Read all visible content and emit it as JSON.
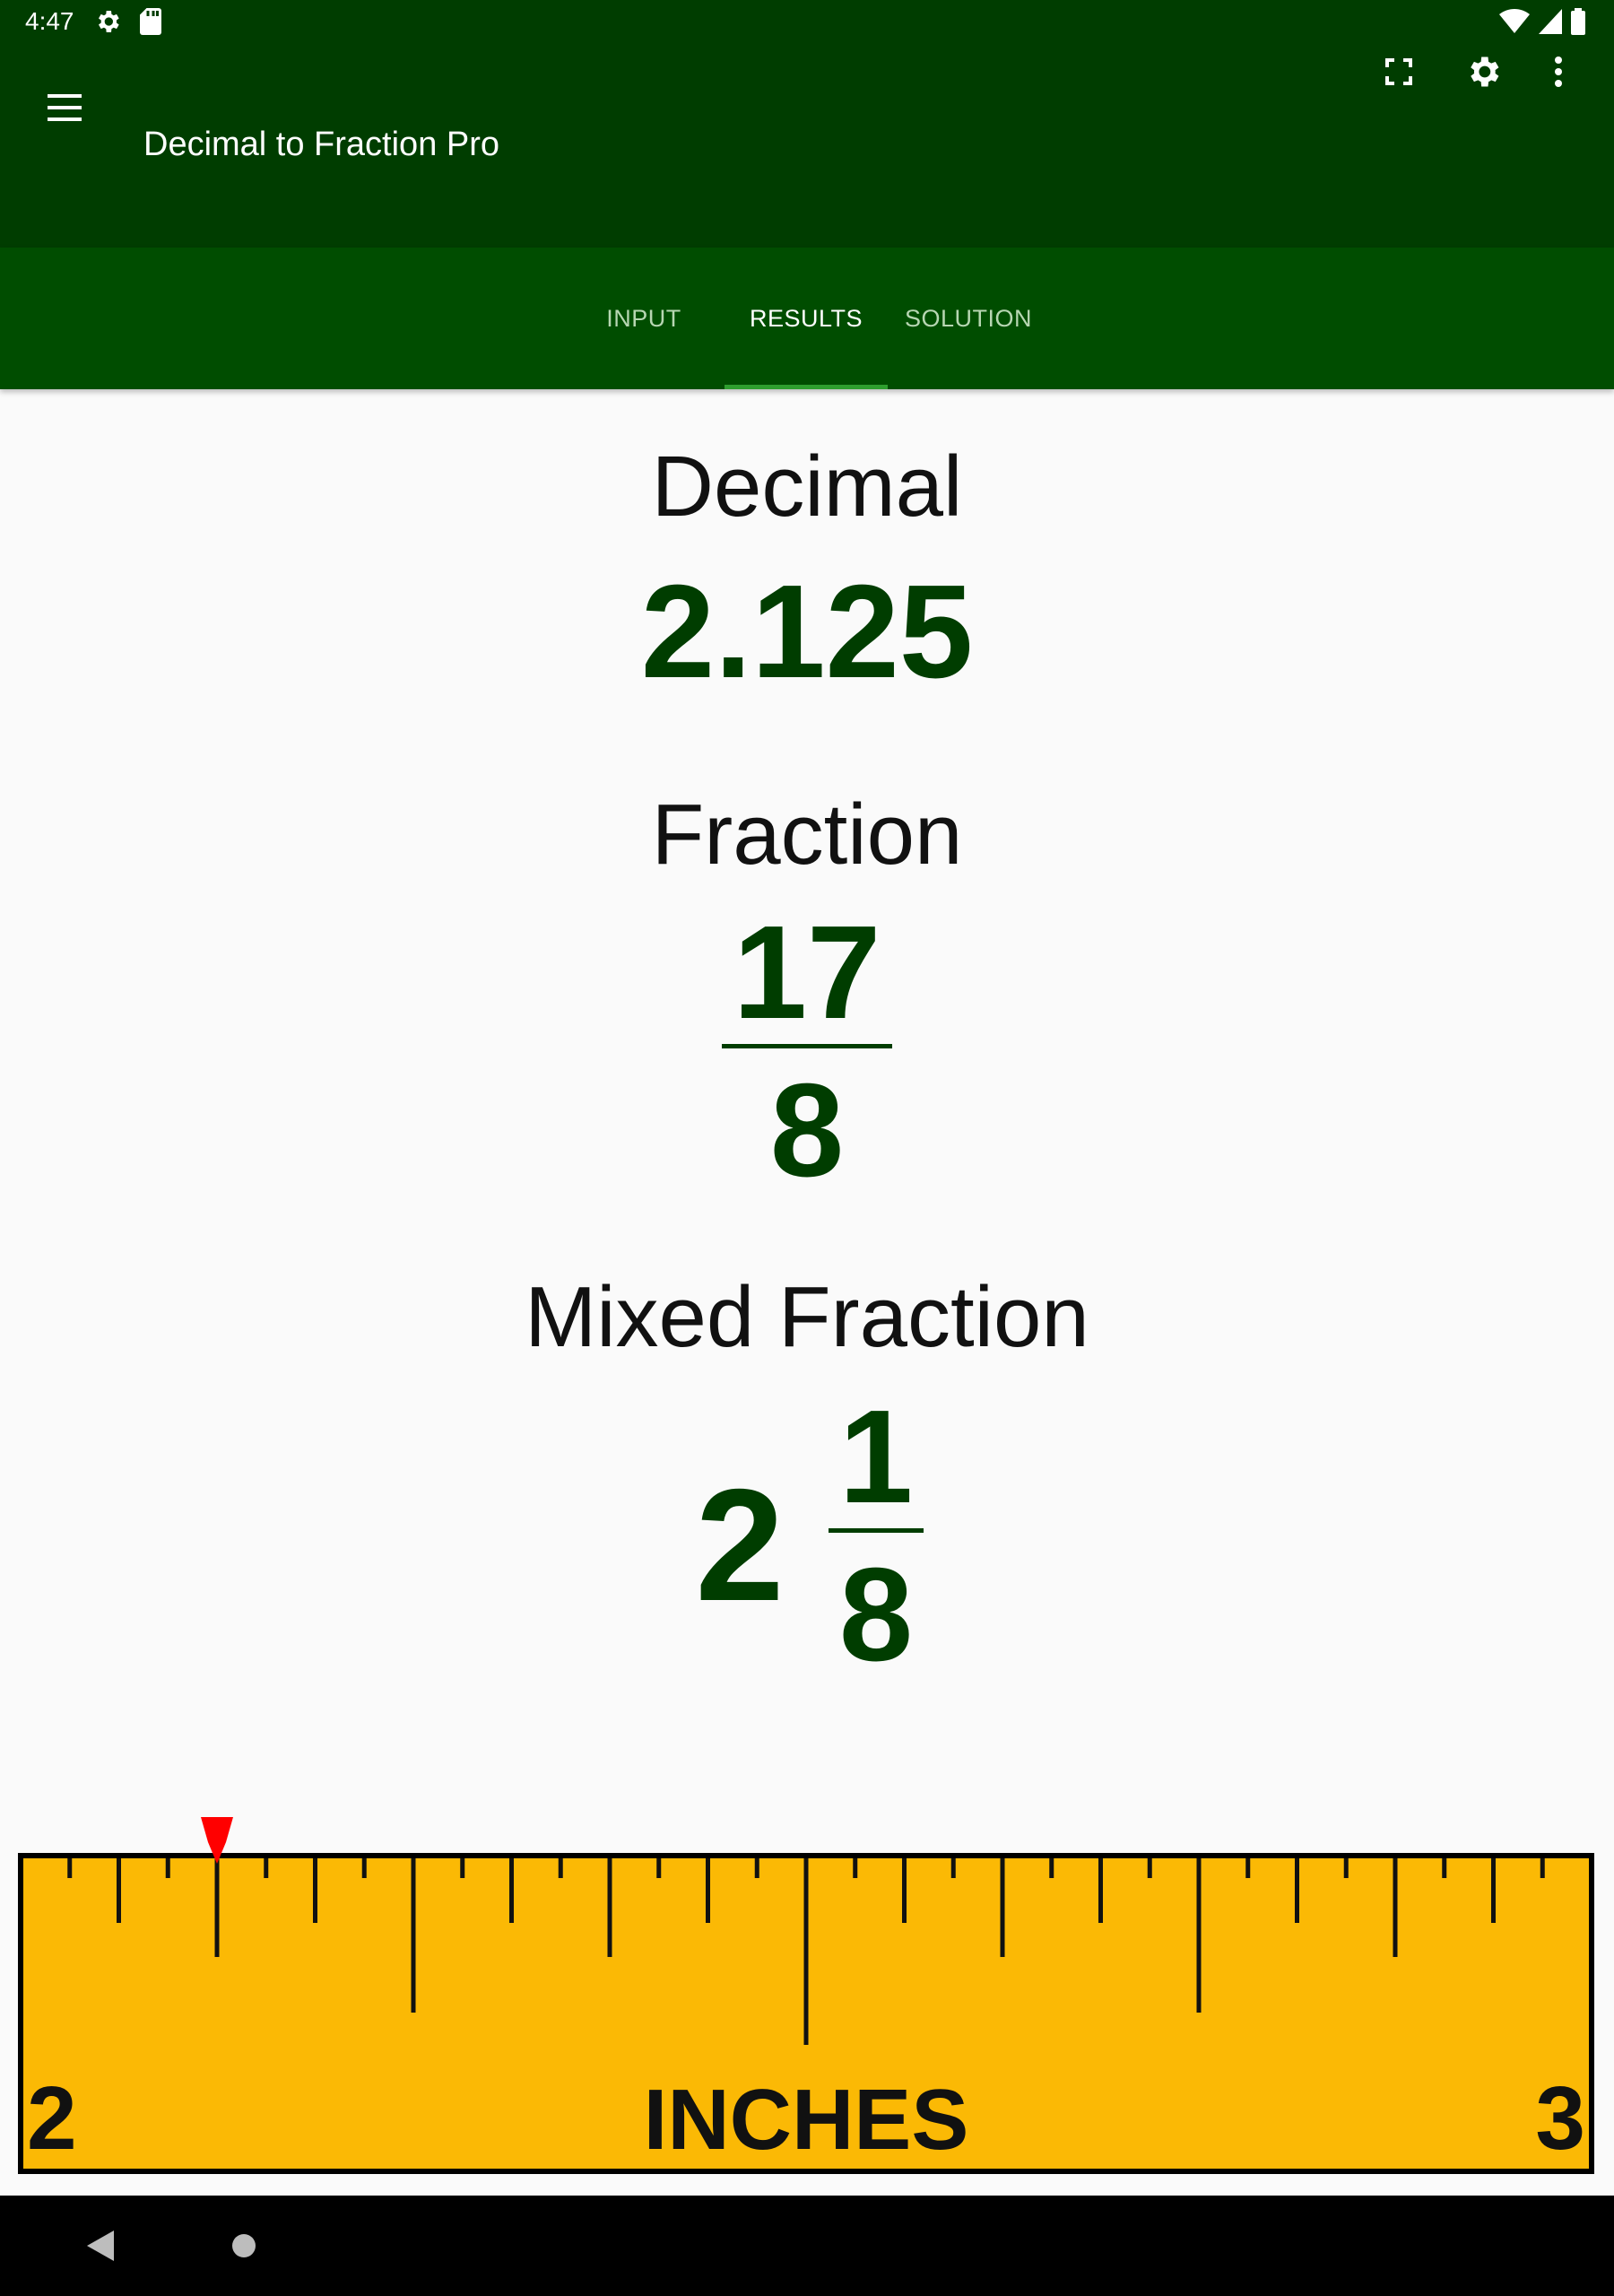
{
  "status_bar": {
    "time": "4:47",
    "icons": [
      "settings-gear-icon",
      "sd-card-icon",
      "wifi-icon",
      "signal-icon",
      "battery-icon"
    ]
  },
  "app_bar": {
    "title": "Decimal to Fraction Pro",
    "icons": [
      "menu-icon",
      "fullscreen-icon",
      "settings-icon",
      "more-vert-icon"
    ],
    "color": "#003d00"
  },
  "tabs": [
    {
      "label": "INPUT",
      "active": false
    },
    {
      "label": "RESULTS",
      "active": true
    },
    {
      "label": "SOLUTION",
      "active": false
    }
  ],
  "results": {
    "decimal_label": "Decimal",
    "decimal_value": "2.125",
    "fraction_label": "Fraction",
    "fraction_numerator": "17",
    "fraction_denominator": "8",
    "mixed_label": "Mixed Fraction",
    "mixed_whole": "2",
    "mixed_numerator": "1",
    "mixed_denominator": "8",
    "value_color": "#003d00"
  },
  "ruler": {
    "start_label": "2",
    "end_label": "3",
    "unit_label": "INCHES",
    "marker_value": 2.125,
    "color": "#fbb905",
    "marker_color": "#ff0000"
  },
  "nav_bar": {
    "icons": [
      "back-icon",
      "home-icon"
    ]
  }
}
